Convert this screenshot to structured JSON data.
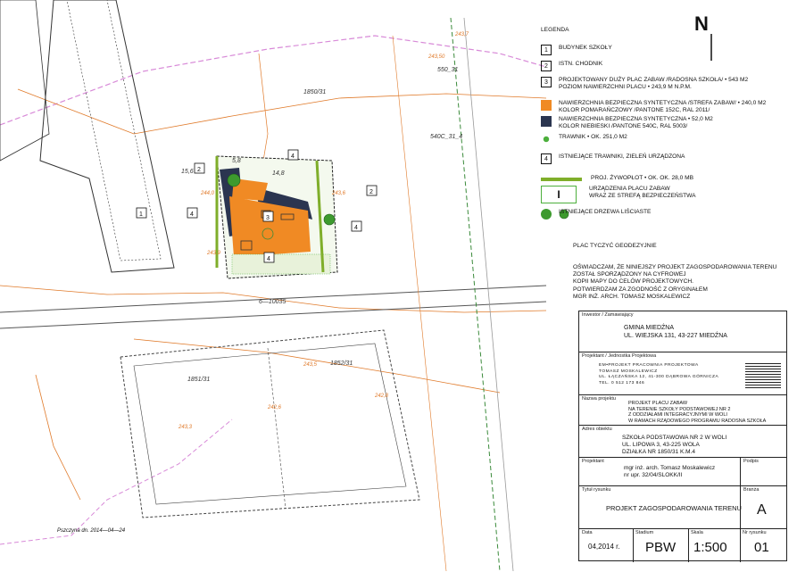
{
  "north_label": "N",
  "legend": {
    "title": "LEGENDA",
    "items": [
      {
        "marker": "1",
        "text": "BUDYNEK SZKOŁY"
      },
      {
        "marker": "2",
        "text": "ISTN. CHODNIK"
      },
      {
        "marker": "3",
        "text": "PROJEKTOWANY DUŻY PLAC ZABAW /RADOSNA SZKOŁA/ • 543 m2\nPOZIOM NAWIERZCHNI PLACU • 243,9 m n.p.m."
      },
      {
        "marker": "orange",
        "text": "NAWIERZCHNIA BEZPIECZNA SYNTETYCZNA /STREFA ZABAW/ • 240,0 m2\nKOLOR POMARAŃCZOWY /PANTONE 152C, RAL 2011/"
      },
      {
        "marker": "navy",
        "text": "NAWIERZCHNIA BEZPIECZNA SYNTETYCZNA • 52,0 m2\nKOLOR NIEBIESKI /PANTONE 540C, RAL 5003/"
      },
      {
        "marker": "grass",
        "text": "TRAWNIK • ok. 251,0 m2"
      },
      {
        "marker": "4",
        "text": "ISTNIEJĄCE TRAWNIKI, ZIELEŃ URZĄDZONA"
      },
      {
        "marker": "hedge",
        "text": "PROJ. ŻYWOPŁOT • ok. ok. 28,0 mb"
      },
      {
        "marker": "device",
        "text": "URZĄDZENIA PLACU ZABAW\nWRAZ ZE STREFĄ BEZPIECZEŃSTWA"
      },
      {
        "marker": "tree",
        "text": "ISTNIEJĄCE DRZEWA LIŚCIASTE"
      }
    ]
  },
  "statement": {
    "line1": "PLAC TYCZYĆ GEODEZYJNIE",
    "line2": "OŚWIADCZAM, ŻE NINIEJSZY PROJEKT ZAGOSPODAROWANIA TERENU\nZOSTAŁ SPORZĄDZONY NA CYFROWEJ\nKOPII MAPY DO CELÓW PROJEKTOWYCH.",
    "line3": "POTWIERDZAM ZA ZGODNOŚĆ Z ORYGINAŁEM\nmgr inż. arch. Tomasz Moskalewicz"
  },
  "title_block": {
    "investor_caption": "Inwestor / Zamawiający",
    "investor": "GMINA MIEDŹNA\nUL. WIEJSKA 131, 43-227 MIEDŹNA",
    "designer_caption": "Projektant / Jednostka Projektowa",
    "designer": "EM•PROJEKT PRACOWNIA PROJEKTOWA\nTOMASZ MOSKALEWICZ\nUL. ŁĄCZAŃSKA 12, 41-300 DĄBROWA GÓRNICZA\nTEL. 0 512 173 846",
    "project_caption": "Nazwa projektu",
    "project": "PROJEKT PLACU ZABAW\nNA TERENIE SZKOŁY PODSTAWOWEJ NR 2\nZ ODDZIAŁAMI INTEGRACYJNYMI W WOLI\nW RAMACH RZĄDOWEGO PROGRAMU RADOSNA SZKOŁA",
    "address_caption": "Adres obiektu",
    "address": "SZKOŁA PODSTAWOWA NR 2 W WOLI\nUL. Lipowa 3, 43-225 Wola\nDZIAŁKA NR 1850/31 k.m.4",
    "author_caption": "Projektant",
    "author": "mgr inż. arch. Tomasz Moskalewicz\nnr upr. 32/04/SLOKK/II",
    "sign_caption": "Podpis",
    "sheet_title_caption": "Tytuł rysunku",
    "sheet_title": "PROJEKT ZAGOSPODAROWANIA TERENU",
    "branch_caption": "Branża",
    "branch": "A",
    "date_caption": "Data",
    "date": "04,2014 r.",
    "stage_caption": "Stadium",
    "stage": "PBW",
    "scale_caption": "Skala",
    "scale": "1:500",
    "sheet_no_caption": "Nr rysunku",
    "sheet_no": "01"
  },
  "map_labels": {
    "plot_a": "1850/31",
    "plot_b": "1851/31",
    "plot_c": "1852/31",
    "plot_d": "540C_31_4",
    "plot_e": "550_31",
    "elev_1": "243,50",
    "elev_2": "243,7",
    "elev_3": "244,0",
    "elev_4": "243,9",
    "elev_5": "243,6",
    "elev_6": "242,8",
    "elev_7": "243,5",
    "elev_8": "243,3",
    "elev_9": "242,6",
    "road_1": "6—10035",
    "dims": "14,8",
    "dims2": "15,6",
    "dims3": "5,8",
    "date_note": "Pszczyna dn. 2014—04—24"
  },
  "colors": {
    "orange": "#f08a24",
    "navy": "#2b3550",
    "grass": "#4caf3c",
    "hedge": "#7fae2a",
    "contour": "#e07a2a",
    "plot_line": "#d88ad8",
    "base_line": "#555555"
  }
}
